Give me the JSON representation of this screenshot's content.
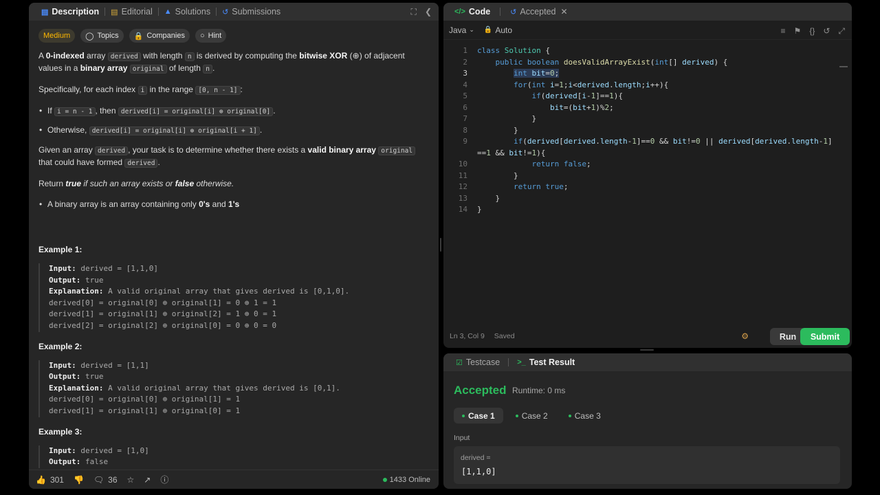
{
  "left_tabs": {
    "description": "Description",
    "editorial": "Editorial",
    "solutions": "Solutions",
    "submissions": "Submissions"
  },
  "chips": {
    "difficulty": "Medium",
    "topics": "Topics",
    "companies": "Companies",
    "hint": "Hint"
  },
  "stats": {
    "likes": "301",
    "comments": "36",
    "online": "1433 Online"
  },
  "code_tabs": {
    "code": "Code",
    "accepted": "Accepted"
  },
  "toolbar": {
    "language": "Java",
    "auto": "Auto"
  },
  "code_lines": [
    "class Solution {",
    "    public boolean doesValidArrayExist(int[] derived) {",
    "        int bit=0;",
    "        for(int i=1;i<derived.length;i++){",
    "            if(derived[i-1]==1){",
    "                bit=(bit+1)%2;",
    "            }",
    "        }",
    "        if(derived[derived.length-1]==0 && bit!=0 || derived[derived.length-1]",
    "==1 && bit!=1){",
    "            return false;",
    "        }",
    "        return true;",
    "    }",
    "}"
  ],
  "editor_status": {
    "position": "Ln 3, Col 9",
    "saved": "Saved"
  },
  "buttons": {
    "run": "Run",
    "submit": "Submit"
  },
  "result_tabs": {
    "testcase": "Testcase",
    "test_result": "Test Result"
  },
  "result": {
    "status": "Accepted",
    "runtime": "Runtime: 0 ms",
    "cases": [
      "Case 1",
      "Case 2",
      "Case 3"
    ],
    "input_label": "Input",
    "var_name": "derived =",
    "var_value": "[1,1,0]"
  },
  "colors": {
    "accent_green": "#2cbb5d",
    "medium": "#ffb800"
  }
}
